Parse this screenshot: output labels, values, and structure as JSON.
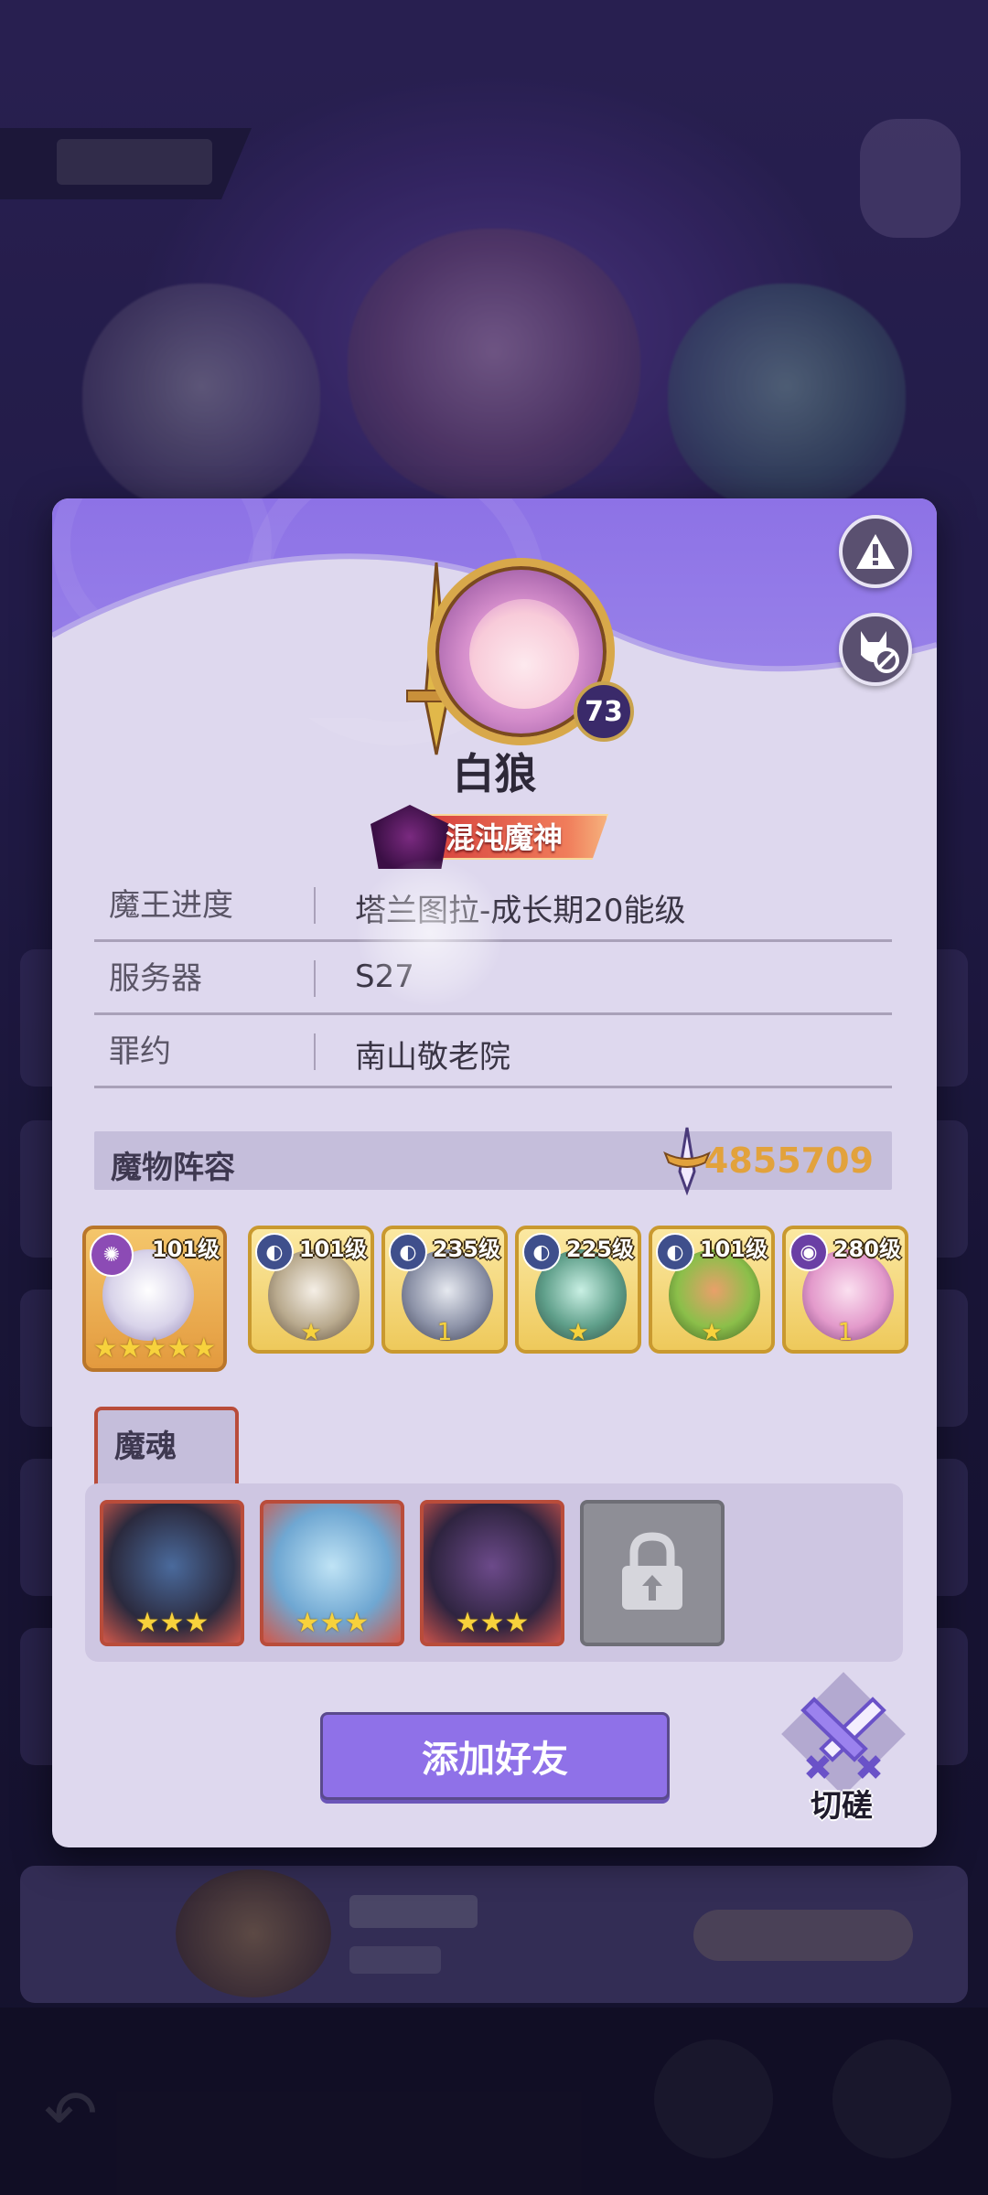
{
  "player": {
    "name": "白狼",
    "level": "73",
    "title": "混沌魔神"
  },
  "info": [
    {
      "key": "魔王进度",
      "value": "塔兰图拉-成长期20能级"
    },
    {
      "key": "服务器",
      "value": "S27"
    },
    {
      "key": "罪约",
      "value": "南山敬老院"
    }
  ],
  "team": {
    "label": "魔物阵容",
    "power": "4855709",
    "heroes": [
      {
        "level": "101级",
        "stars": "★★★★★",
        "class_icon": "spiral-class-icon"
      },
      {
        "level": "101级",
        "stars": "★",
        "class_icon": "wolf-class-icon"
      },
      {
        "level": "235级",
        "stars": "1",
        "class_icon": "wolf-class-icon"
      },
      {
        "level": "225级",
        "stars": "★",
        "class_icon": "wolf-class-icon"
      },
      {
        "level": "101级",
        "stars": "★",
        "class_icon": "wolf-class-icon"
      },
      {
        "level": "280级",
        "stars": "1",
        "class_icon": "eye-class-icon"
      }
    ]
  },
  "souls": {
    "label": "魔魂",
    "items": [
      {
        "stars": "★★★"
      },
      {
        "stars": "★★★"
      },
      {
        "stars": "★★★"
      }
    ]
  },
  "actions": {
    "add_friend": "添加好友",
    "duel": "切磋"
  },
  "colors": {
    "accent": "#8f71e8",
    "power_gold": "#e2a23c",
    "card_bg": "#ded8ee"
  }
}
